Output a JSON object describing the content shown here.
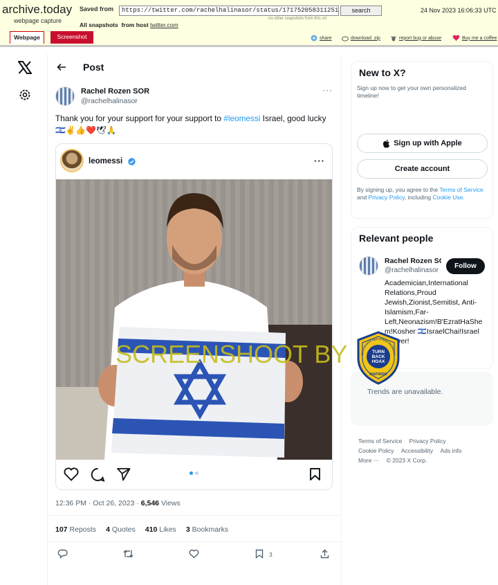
{
  "archive": {
    "logo": "archive.today",
    "subtitle": "webpage capture",
    "saved_from_label": "Saved from",
    "url": "https://twitter.com/rachelhalinasor/status/1717520583112511641?s=20",
    "search_label": "search",
    "no_other_snapshots": "no other snapshots from this url",
    "date": "24 Nov 2023 16:06:33 UTC",
    "all_snapshots_label": "All snapshots",
    "from_host_label": "from host",
    "host": "twitter.com",
    "tabs": [
      "Webpage",
      "Screenshot"
    ],
    "links": [
      "share",
      "download .zip",
      "report bug or abuse",
      "Buy me a coffee"
    ]
  },
  "post": {
    "header_title": "Post",
    "author_name": "Rachel Rozen SOR",
    "author_handle": "@rachelhalinasor",
    "text_before": "Thank you for your support for your support to ",
    "hashtag": "#leomessi",
    "text_after": " Israel, good lucky ",
    "emojis": "🇮🇱✌👍❤️🕊🙏",
    "embed": {
      "username": "leomessi"
    },
    "time": "12:36 PM · Oct 26, 2023 · ",
    "views_count": "6,546",
    "views_label": "Views",
    "stats": {
      "reposts_count": "107",
      "reposts_label": "Reposts",
      "quotes_count": "4",
      "quotes_label": "Quotes",
      "likes_count": "410",
      "likes_label": "Likes",
      "bookmarks_count": "3",
      "bookmarks_label": "Bookmarks"
    },
    "bookmark_action_count": "3"
  },
  "sidebar": {
    "new_to_x_title": "New to X?",
    "new_to_x_desc": "Sign up now to get your own personalized timeline!",
    "signup_apple_label": "Sign up with Apple",
    "create_account_label": "Create account",
    "terms_prefix": "By signing up, you agree to the ",
    "terms_link": "Terms of Service",
    "terms_and": " and ",
    "privacy_link": "Privacy Policy",
    "terms_including": ", including ",
    "cookie_link": "Cookie Use",
    "terms_suffix": ".",
    "relevant_title": "Relevant people",
    "person_name": "Rachel Rozen SOR",
    "person_handle": "@rachelhalinasor",
    "follow_label": "Follow",
    "person_bio": "Academician,International Relations,Proud Jewish,Zionist,Semitist, Anti-Islamism,Far-Left,Neonazism!B'EzratHaShem!Kosher 🇮🇱IsraelChai!Israel forever!",
    "trends_text": "Trends are unavailable.",
    "footer_links": [
      "Terms of Service",
      "Privacy Policy",
      "Cookie Policy",
      "Accessibility",
      "Ads info",
      "More ···",
      "© 2023 X Corp."
    ]
  },
  "overlay": {
    "watermark_text": "SCREENSHOOT BY",
    "badge_top_text": "MASYARAKAT ANTI FITNAH INDONESIA",
    "badge_center_lines": [
      "TURN",
      "BACK",
      "HOAX"
    ],
    "badge_bottom_text": "MAFINDO"
  }
}
